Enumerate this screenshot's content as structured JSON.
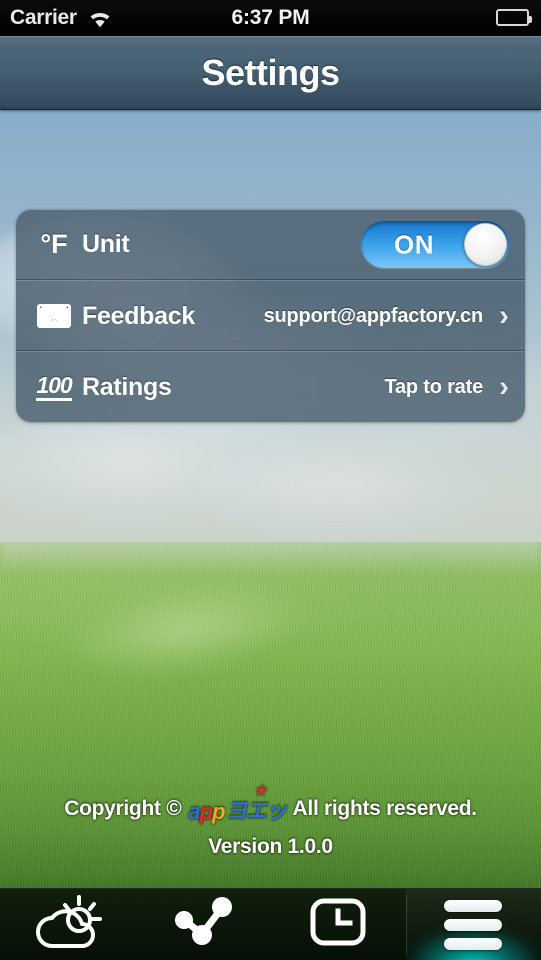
{
  "status_bar": {
    "carrier": "Carrier",
    "time": "6:37 PM",
    "wifi_icon": "wifi-icon",
    "battery_icon": "battery-full-icon"
  },
  "nav": {
    "title": "Settings"
  },
  "settings": {
    "rows": [
      {
        "icon": "degree-fahrenheit-icon",
        "icon_text": "°F",
        "label": "Unit",
        "control": "toggle",
        "toggle_label": "ON",
        "toggle_on": true
      },
      {
        "icon": "envelope-icon",
        "label": "Feedback",
        "value": "support@appfactory.cn",
        "chevron": "chevron-right-icon"
      },
      {
        "icon": "hundred-points-icon",
        "icon_text": "100",
        "label": "Ratings",
        "value": "Tap to rate",
        "chevron": "chevron-right-icon"
      }
    ]
  },
  "footer": {
    "copyright_prefix": "Copyright ©",
    "brand": {
      "part1": "a",
      "part2": "p",
      "part3": "p",
      "part4": "ヨエッ",
      "star": "★"
    },
    "copyright_suffix": "All rights reserved.",
    "version": "Version 1.0.0"
  },
  "tabbar": {
    "tabs": [
      {
        "name": "tab-weather",
        "icon": "partly-cloudy-icon",
        "active": false
      },
      {
        "name": "tab-trend",
        "icon": "share-nodes-icon",
        "active": false
      },
      {
        "name": "tab-widget",
        "icon": "clock-widget-icon",
        "active": false
      },
      {
        "name": "tab-menu",
        "icon": "hamburger-menu-icon",
        "active": true
      }
    ]
  },
  "colors": {
    "accent_toggle": "#2b91e0",
    "active_tab_glow": "#00e5db",
    "navbar": "#456074",
    "panel": "#4a5e6e"
  }
}
